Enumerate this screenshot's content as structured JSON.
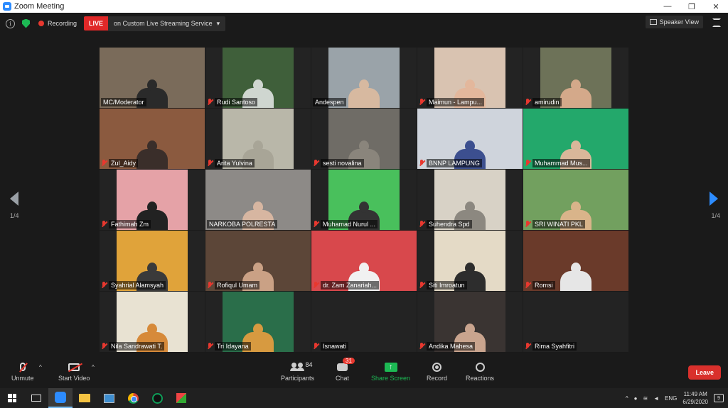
{
  "window": {
    "title": "Zoom Meeting",
    "minimize": "—",
    "restore": "❐",
    "close": "✕"
  },
  "topbar": {
    "recording_label": "Recording",
    "live_label": "LIVE",
    "stream_label": "on Custom Live Streaming Service",
    "speaker_view_label": "Speaker View"
  },
  "gallery": {
    "page_left": "1/4",
    "page_right": "1/4",
    "tiles": [
      {
        "name": "MC/Moderator",
        "muted": false,
        "active": true,
        "bg": "#7a6b5a",
        "fg": "#2a2a2a"
      },
      {
        "name": "Rudi Santoso",
        "muted": true,
        "bg": "#3f5f3a",
        "fg": "#cfd6d0"
      },
      {
        "name": "Andespen",
        "muted": false,
        "bg": "#9aa3a9",
        "fg": "#d7b9a0"
      },
      {
        "name": "Maimun - Lampu...",
        "muted": true,
        "bg": "#d9c3b1",
        "fg": "#e3b79c"
      },
      {
        "name": "amirudin",
        "muted": true,
        "bg": "#6d7258",
        "fg": "#d4a98a"
      },
      {
        "name": "Zul_Aidy",
        "muted": true,
        "bg": "#8b5a3f",
        "fg": "#3a2e2a"
      },
      {
        "name": "Arita Yulvina",
        "muted": true,
        "bg": "#b9b7a9",
        "fg": "#a8a597"
      },
      {
        "name": "sesti novalina",
        "muted": true,
        "bg": "#6f6c66",
        "fg": "#8a857c"
      },
      {
        "name": "BNNP LAMPUNG",
        "muted": true,
        "bg": "#cfd4dc",
        "fg": "#3c4f8f"
      },
      {
        "name": "Muhammad Mus...",
        "muted": true,
        "bg": "#23a86b",
        "fg": "#d9b79a"
      },
      {
        "name": "Fathimah Zm",
        "muted": true,
        "bg": "#e5a2a7",
        "fg": "#222"
      },
      {
        "name": "NARKOBA POLRESTA",
        "muted": false,
        "bg": "#8d8a87",
        "fg": "#d7b6a1"
      },
      {
        "name": "Muhamad Nurul ...",
        "muted": true,
        "bg": "#49c05c",
        "fg": "#333"
      },
      {
        "name": "Suhendra Spd",
        "muted": true,
        "bg": "#d8d2c6",
        "fg": "#8c8880"
      },
      {
        "name": "SRI WINATI PKL",
        "muted": true,
        "bg": "#72a05f",
        "fg": "#d9b48a"
      },
      {
        "name": "Syahrial Alamsyah",
        "muted": true,
        "bg": "#e0a33a",
        "fg": "#3a3a3a"
      },
      {
        "name": "Rofiqul Umam",
        "muted": true,
        "bg": "#5c4638",
        "fg": "#caa185"
      },
      {
        "name": "dr. Zam Zanariah...",
        "muted": true,
        "bg": "#d8484c",
        "fg": "#f1f1f1"
      },
      {
        "name": "Siti Imroatun",
        "muted": true,
        "bg": "#e4dac6",
        "fg": "#2d2d2d"
      },
      {
        "name": "Romsi",
        "muted": true,
        "bg": "#6a3a2a",
        "fg": "#e6e6e6"
      },
      {
        "name": "Nila Sandrawati T.",
        "muted": true,
        "bg": "#e8e2d2",
        "fg": "#d68a3a"
      },
      {
        "name": "Tri Idayana",
        "muted": true,
        "bg": "#2a6e4a",
        "fg": "#d79a40"
      },
      {
        "name": "Isnawati",
        "muted": true,
        "bg": "",
        "fg": ""
      },
      {
        "name": "Andika Mahesa",
        "muted": true,
        "bg": "#3a3432",
        "fg": "#c9a48e"
      },
      {
        "name": "Rima Syahfitri",
        "muted": true,
        "bg": "",
        "fg": ""
      }
    ]
  },
  "toolbar": {
    "unmute_label": "Unmute",
    "start_video_label": "Start Video",
    "participants_label": "Participants",
    "participants_count": "84",
    "chat_label": "Chat",
    "chat_badge": "31",
    "share_label": "Share Screen",
    "record_label": "Record",
    "reactions_label": "Reactions",
    "leave_label": "Leave"
  },
  "taskbar": {
    "lang": "ENG",
    "time": "11:49 AM",
    "date": "6/29/2020",
    "notif_count": "9"
  }
}
